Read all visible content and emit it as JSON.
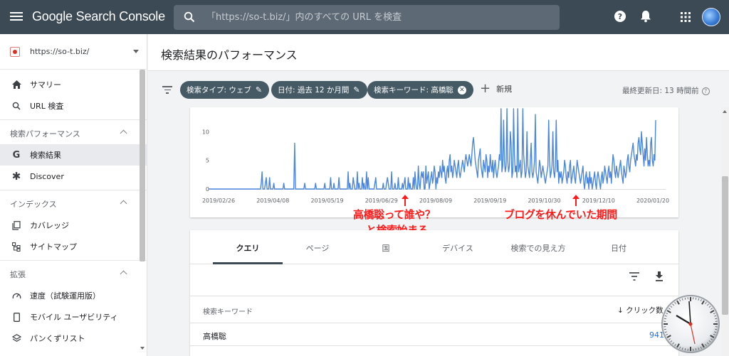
{
  "app": {
    "title": "Google Search Console"
  },
  "search": {
    "placeholder": "「https://so-t.biz/」内のすべての URL を検査"
  },
  "property": {
    "label": "https://so-t.biz/"
  },
  "sidebar": {
    "top_items": [
      {
        "label": "サマリー",
        "icon": "home-icon"
      },
      {
        "label": "URL 検査",
        "icon": "search-icon"
      }
    ],
    "sections": [
      {
        "title": "検索パフォーマンス",
        "items": [
          {
            "label": "検索結果",
            "icon": "google-g-icon",
            "active": true
          },
          {
            "label": "Discover",
            "icon": "asterisk-icon"
          }
        ]
      },
      {
        "title": "インデックス",
        "items": [
          {
            "label": "カバレッジ",
            "icon": "coverage-icon"
          },
          {
            "label": "サイトマップ",
            "icon": "sitemap-icon"
          }
        ]
      },
      {
        "title": "拡張",
        "items": [
          {
            "label": "速度（試験運用版）",
            "icon": "speed-icon"
          },
          {
            "label": "モバイル ユーザビリティ",
            "icon": "mobile-icon"
          },
          {
            "label": "パンくずリスト",
            "icon": "layers-icon"
          }
        ]
      }
    ]
  },
  "page": {
    "title": "検索結果のパフォーマンス"
  },
  "filters": {
    "chips": [
      "検索タイプ: ウェブ",
      "日付: 過去 12 か月間",
      "検索キーワード: 高橋聡"
    ],
    "new_label": "新規",
    "updated": "最終更新日: 13 時間前"
  },
  "chart_data": {
    "type": "line",
    "x_ticks": [
      "2019/02/26",
      "2019/04/08",
      "2019/05/19",
      "2019/06/29",
      "2019/08/09",
      "2019/09/19",
      "2019/10/30",
      "2019/12/10",
      "2020/01/20"
    ],
    "y_ticks": [
      "0",
      "5",
      "10"
    ],
    "ylim": [
      0,
      14
    ],
    "series": [
      {
        "color": "#4a86e0",
        "values": [
          0,
          0,
          0,
          0,
          0,
          0,
          0,
          0,
          0,
          0,
          0,
          0,
          0,
          0,
          0,
          0,
          0,
          0,
          0,
          0,
          0,
          0,
          0,
          0,
          0,
          0,
          0,
          0,
          0,
          0,
          0,
          0,
          0,
          0,
          0,
          0,
          0,
          0,
          0,
          0,
          0,
          0,
          0,
          0,
          0,
          0,
          0,
          0,
          0,
          0,
          0,
          0,
          0,
          0,
          0,
          0,
          0,
          0,
          0,
          0,
          0,
          0,
          0,
          1,
          3,
          0,
          0,
          0,
          1,
          2,
          0,
          0,
          0,
          2,
          0,
          0,
          0,
          0,
          1,
          0,
          0,
          0,
          0,
          0,
          0,
          0,
          0,
          0,
          0,
          0,
          1,
          0,
          0,
          0,
          0,
          0,
          0,
          0,
          0,
          0,
          0,
          0,
          0,
          8,
          0,
          0,
          0,
          0,
          0,
          0,
          0,
          0,
          0,
          0,
          0,
          1,
          0,
          0,
          0,
          0,
          0,
          0,
          0,
          0,
          0,
          0,
          0,
          0,
          1,
          0,
          0,
          0,
          0,
          0,
          0,
          0,
          0,
          0,
          0,
          1,
          0,
          0,
          0,
          0,
          0,
          0,
          2,
          0,
          0,
          0,
          1,
          0,
          0,
          0,
          0,
          0,
          2,
          0,
          0,
          0,
          0,
          0,
          0,
          0,
          0,
          0,
          0,
          3,
          0,
          1,
          0,
          0,
          0,
          2,
          1,
          0,
          0,
          0,
          3,
          0,
          1,
          0,
          0,
          0,
          2,
          0,
          1,
          0,
          0,
          3,
          0,
          2,
          0,
          0,
          0,
          0,
          0,
          0,
          0,
          1,
          2,
          0,
          0,
          0,
          0,
          0,
          0,
          0,
          0,
          1,
          0,
          0,
          0,
          1,
          2,
          1,
          0,
          0,
          0,
          3,
          0,
          0,
          0,
          1,
          0,
          0,
          0,
          2,
          0,
          0,
          0,
          0,
          1,
          0,
          1,
          2,
          0,
          0,
          0,
          2,
          0,
          1,
          0,
          0,
          0,
          2,
          0,
          3,
          1,
          0,
          0,
          4,
          1,
          0,
          2,
          3,
          2,
          3,
          0,
          0,
          4,
          1,
          2,
          3,
          0,
          1,
          2,
          3,
          1,
          2,
          4,
          3,
          0,
          2,
          1,
          3,
          2,
          4,
          3,
          2,
          5,
          3,
          4,
          2,
          1,
          3,
          4,
          2,
          5,
          6,
          3,
          4,
          2,
          3,
          5,
          4,
          3,
          2,
          4,
          5,
          3,
          2,
          3,
          4,
          5,
          4,
          3,
          5,
          6,
          5,
          4,
          5,
          6,
          5,
          4,
          6,
          8,
          9,
          7,
          5,
          4,
          3,
          2,
          5,
          6,
          7,
          4,
          3,
          2,
          5,
          4,
          3,
          6,
          5,
          2,
          4,
          3,
          6,
          4,
          3,
          5,
          2,
          4,
          5,
          3,
          2,
          3,
          4,
          6,
          5,
          14,
          3,
          4,
          12,
          5,
          3,
          4,
          14,
          5,
          3,
          4,
          10,
          8,
          2,
          3,
          14,
          6,
          3,
          4,
          2,
          14,
          3,
          4,
          5,
          2,
          3,
          14,
          6,
          4,
          2,
          3,
          10,
          4,
          3,
          2,
          5,
          8,
          3,
          2,
          3,
          5,
          13,
          3,
          2,
          1,
          3,
          5,
          4,
          2,
          3,
          4,
          3,
          2,
          1,
          2,
          3,
          4,
          12,
          5,
          2,
          3,
          4,
          10,
          3,
          2,
          4,
          12,
          3,
          5,
          1,
          3,
          2,
          3,
          1,
          2,
          3,
          5,
          4,
          2,
          1,
          3,
          2,
          4,
          5,
          1,
          2,
          3,
          4,
          2,
          1,
          3,
          5,
          4,
          3,
          2,
          1,
          2,
          3,
          4,
          1,
          0,
          2,
          3,
          1,
          2,
          0,
          3,
          1,
          2,
          0,
          1,
          2,
          3,
          1,
          0,
          2,
          3,
          2,
          1,
          0,
          2,
          3,
          1,
          2,
          4,
          3,
          2,
          1,
          3,
          4,
          2,
          3,
          1,
          4,
          6,
          5,
          3,
          2,
          4,
          3,
          2,
          3,
          4,
          5,
          3,
          2,
          1,
          4,
          3,
          2,
          3,
          5,
          6,
          4,
          3,
          5,
          6,
          7,
          8,
          6,
          5,
          4,
          6,
          5,
          8,
          9,
          7,
          6,
          10,
          8,
          6,
          4,
          7,
          5,
          9,
          6,
          4,
          5,
          4,
          8,
          9,
          5,
          4,
          6,
          5,
          12
        ]
      }
    ]
  },
  "annotations": {
    "left": "高橋聡って誰や？\nと検索始まる",
    "right": "ブログを休んでいた期間"
  },
  "table": {
    "tabs": [
      "クエリ",
      "ページ",
      "国",
      "デバイス",
      "検索での見え方",
      "日付"
    ],
    "active_tab": 0,
    "col_query": "検索キーワード",
    "col_clicks": "クリック数",
    "rows": [
      {
        "query": "高橋聡",
        "clicks": "941"
      }
    ]
  }
}
